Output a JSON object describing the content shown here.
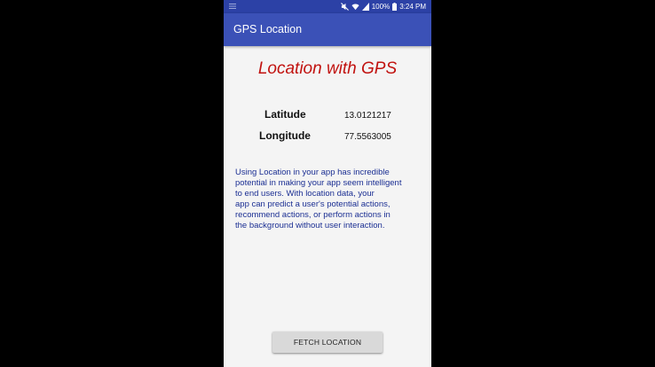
{
  "status_bar": {
    "battery": "100%",
    "time": "3:24 PM",
    "icons": [
      "mute-icon",
      "wifi-icon",
      "signal-icon",
      "battery-icon"
    ]
  },
  "app_bar": {
    "title": "GPS Location",
    "color": "#3b51b7"
  },
  "main": {
    "heading": "Location with GPS",
    "heading_color": "#c1120f",
    "latitude_label": "Latitude",
    "latitude_value": "13.0121217",
    "longitude_label": "Longitude",
    "longitude_value": "77.5563005",
    "description_lines": [
      "Using Location in your app has incredible",
      "potential in making your app seem intelligent",
      "to end users. With location data, your",
      "app can predict a user's potential actions,",
      "recommend actions, or perform actions in",
      "the background without user interaction."
    ],
    "description_color": "#1b2f93",
    "fetch_button_label": "FETCH LOCATION"
  }
}
